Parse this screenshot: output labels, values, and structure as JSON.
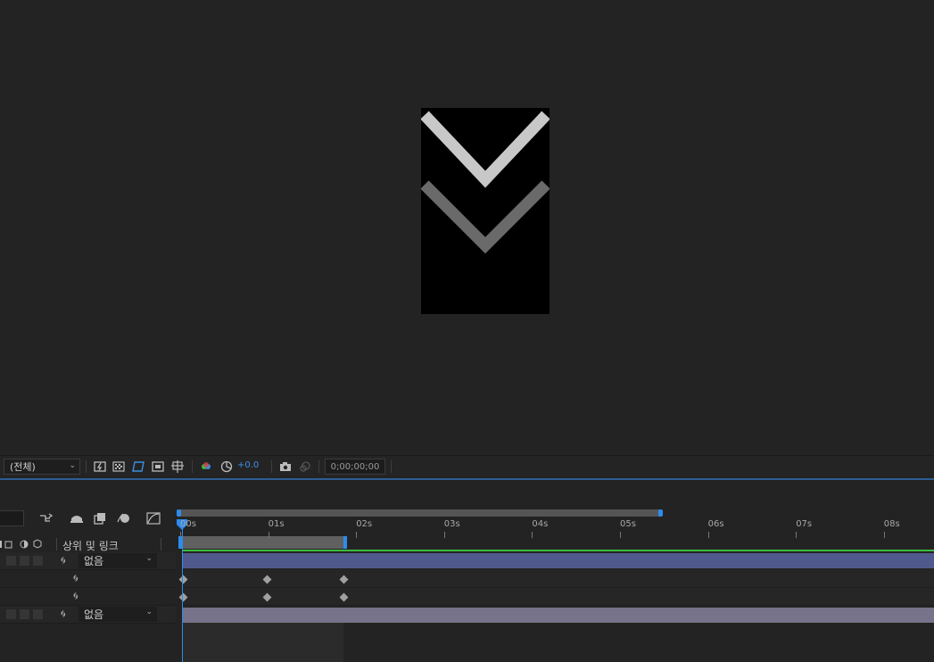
{
  "viewer": {
    "resolution": "(전체)",
    "exposure": "+0.0",
    "timecode": "0;00;00;00"
  },
  "timeline": {
    "column_header": "상위 및 링크",
    "ruler_labels": [
      "00s",
      "01s",
      "02s",
      "03s",
      "04s",
      "05s",
      "06s",
      "07s",
      "08s"
    ],
    "layers": [
      {
        "parent": "없음",
        "color": "#50598c"
      },
      {
        "parent": "없음",
        "color": "#77738a"
      }
    ],
    "accent_color": "#2d8ceb",
    "icons": [
      "shy-layers-icon",
      "frame-blending-icon",
      "motion-blur-icon",
      "graph-editor-icon",
      "draft-3d-icon",
      "comp-flowchart-icon"
    ]
  }
}
